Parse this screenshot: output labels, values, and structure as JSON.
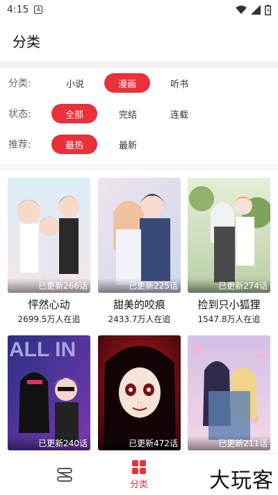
{
  "status": {
    "time": "4:15",
    "notif_icon": "A"
  },
  "header": {
    "title": "分类"
  },
  "filters": [
    {
      "label": "分类:",
      "options": [
        "小说",
        "漫画",
        "听书"
      ],
      "selected": 1
    },
    {
      "label": "状态:",
      "options": [
        "全部",
        "完结",
        "连载"
      ],
      "selected": 0
    },
    {
      "label": "推荐:",
      "options": [
        "最热",
        "最新"
      ],
      "selected": 0
    }
  ],
  "comics": [
    {
      "title": "怦然心动",
      "readers": "2699.5万人在追",
      "badge": "已更新266话",
      "palette": [
        "#cfe6ef",
        "#f4cfd8",
        "#2a2a2a"
      ]
    },
    {
      "title": "甜美的咬痕",
      "readers": "2433.7万人在追",
      "badge": "已更新225话",
      "palette": [
        "#e9d8e8",
        "#f3c7a9",
        "#3a4a78"
      ]
    },
    {
      "title": "捡到只小狐狸",
      "readers": "1547.8万人在追",
      "badge": "已更新274话",
      "palette": [
        "#d8e9c8",
        "#f2f2f2",
        "#7b8f6a"
      ]
    },
    {
      "title": "",
      "readers": "",
      "badge": "已更新240话",
      "palette": [
        "#2b2f86",
        "#6a3aa8",
        "#111111"
      ]
    },
    {
      "title": "",
      "readers": "",
      "badge": "已更新472话",
      "palette": [
        "#8a0d12",
        "#2b0608",
        "#f0e0d0"
      ]
    },
    {
      "title": "",
      "readers": "",
      "badge": "已更新211话",
      "palette": [
        "#cdb8df",
        "#f3d4e2",
        "#4a3c6a"
      ]
    }
  ],
  "bottom_nav": {
    "items": [
      "",
      "分类"
    ],
    "active": 1
  },
  "watermark": "大玩客",
  "accent": "#e8313a"
}
